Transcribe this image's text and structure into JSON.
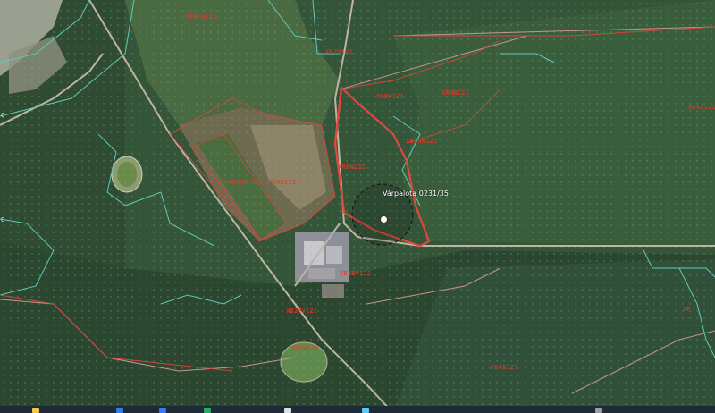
{
  "map": {
    "location_label": "Várpalota 0231/35",
    "parcel_labels": [
      "XRPK8121",
      "XR29121",
      "XRBW121",
      "XRNW121",
      "XB1NW121",
      "XRPW121",
      "XWK48121",
      "XXK48121",
      "XB1BV121",
      "XB2BV121",
      "XRSW121",
      "XK45121",
      "XK43121",
      "XR"
    ],
    "edge_marks": [
      "0",
      "0"
    ],
    "colors": {
      "parcel_line": "#d9443a",
      "highlight_line": "#e0483c",
      "boundary_line": "#5fc9b8",
      "road": "#b9b0a0",
      "dot_overlay": "#5a8a76",
      "marker": "#ffffff"
    }
  },
  "taskbar": {
    "icons": [
      "start-icon",
      "file-explorer-icon",
      "browser-icon",
      "app-icon",
      "document-icon",
      "map-icon",
      "network-icon"
    ]
  }
}
